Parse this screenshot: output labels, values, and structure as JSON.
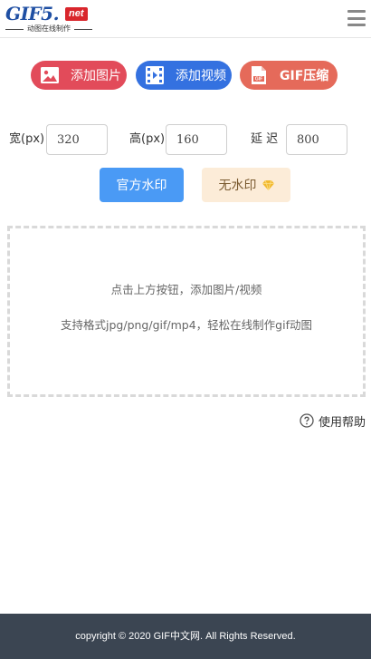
{
  "header": {
    "logo_main": "GIF5",
    "logo_dot": ".",
    "logo_net": "net",
    "logo_subtitle": "动图在线制作"
  },
  "actions": {
    "add_image": "添加图片",
    "add_video": "添加视频",
    "gif_compress": "GIF压缩",
    "gif_icon_text": "GIF"
  },
  "params": {
    "width_label": "宽(px)",
    "width_value": "320",
    "height_label": "高(px)",
    "height_value": "160",
    "delay_label": "延 迟",
    "delay_value": "800"
  },
  "watermark": {
    "official": "官方水印",
    "none": "无水印"
  },
  "dropzone": {
    "line1": "点击上方按钮，添加图片/视频",
    "line2": "支持格式jpg/png/gif/mp4，轻松在线制作gif动图"
  },
  "help": {
    "label": "使用帮助"
  },
  "footer": {
    "copyright": "copyright © 2020 GIF中文网. All Rights Reserved."
  },
  "colors": {
    "add_image_bg": "#e24b5a",
    "add_video_bg": "#3471e0",
    "gif_compress_bg": "#e56a5a",
    "official_wm_bg": "#4a9af5",
    "no_wm_bg": "#fcecd8",
    "footer_bg": "#3b4552",
    "logo_blue": "#1f4fa3",
    "logo_red": "#d9262c"
  },
  "icons": {
    "add_image": "image-icon",
    "add_video": "film-icon",
    "gif_compress": "gif-file-icon",
    "no_watermark": "diamond-icon",
    "help": "question-circle-icon",
    "menu": "hamburger-menu-icon"
  }
}
